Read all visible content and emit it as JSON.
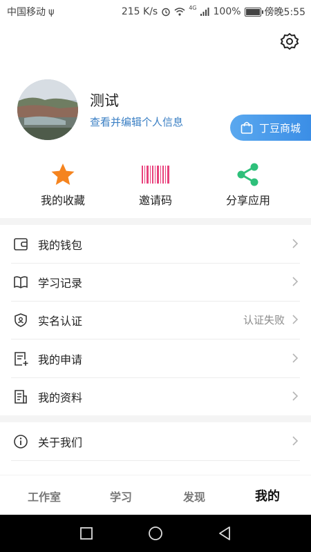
{
  "status_bar": {
    "carrier": "中国移动",
    "net_speed": "215 K/s",
    "battery": "100%",
    "time": "傍晚5:55",
    "signal_label": "4G"
  },
  "profile": {
    "name": "测试",
    "edit_link": "查看并编辑个人信息",
    "shop_button": "丁豆商城"
  },
  "quick_actions": [
    {
      "label": "我的收藏",
      "icon": "star-icon",
      "color": "#f5841f"
    },
    {
      "label": "邀请码",
      "icon": "barcode-icon",
      "color": "#e8417c"
    },
    {
      "label": "分享应用",
      "icon": "share-icon",
      "color": "#2ec07a"
    }
  ],
  "menu": [
    {
      "label": "我的钱包",
      "icon": "wallet-icon",
      "value": ""
    },
    {
      "label": "学习记录",
      "icon": "book-icon",
      "value": ""
    },
    {
      "label": "实名认证",
      "icon": "shield-id-icon",
      "value": "认证失败"
    },
    {
      "label": "我的申请",
      "icon": "application-icon",
      "value": ""
    },
    {
      "label": "我的资料",
      "icon": "document-icon",
      "value": ""
    },
    {
      "label": "关于我们",
      "icon": "info-icon",
      "value": ""
    }
  ],
  "tabs": [
    {
      "label": "工作室",
      "active": false
    },
    {
      "label": "学习",
      "active": false
    },
    {
      "label": "发现",
      "active": false
    },
    {
      "label": "我的",
      "active": true
    }
  ],
  "colors": {
    "accent": "#3b8ee6",
    "link": "#3a7fc4",
    "tab_highlight": "#8fd0f4"
  }
}
